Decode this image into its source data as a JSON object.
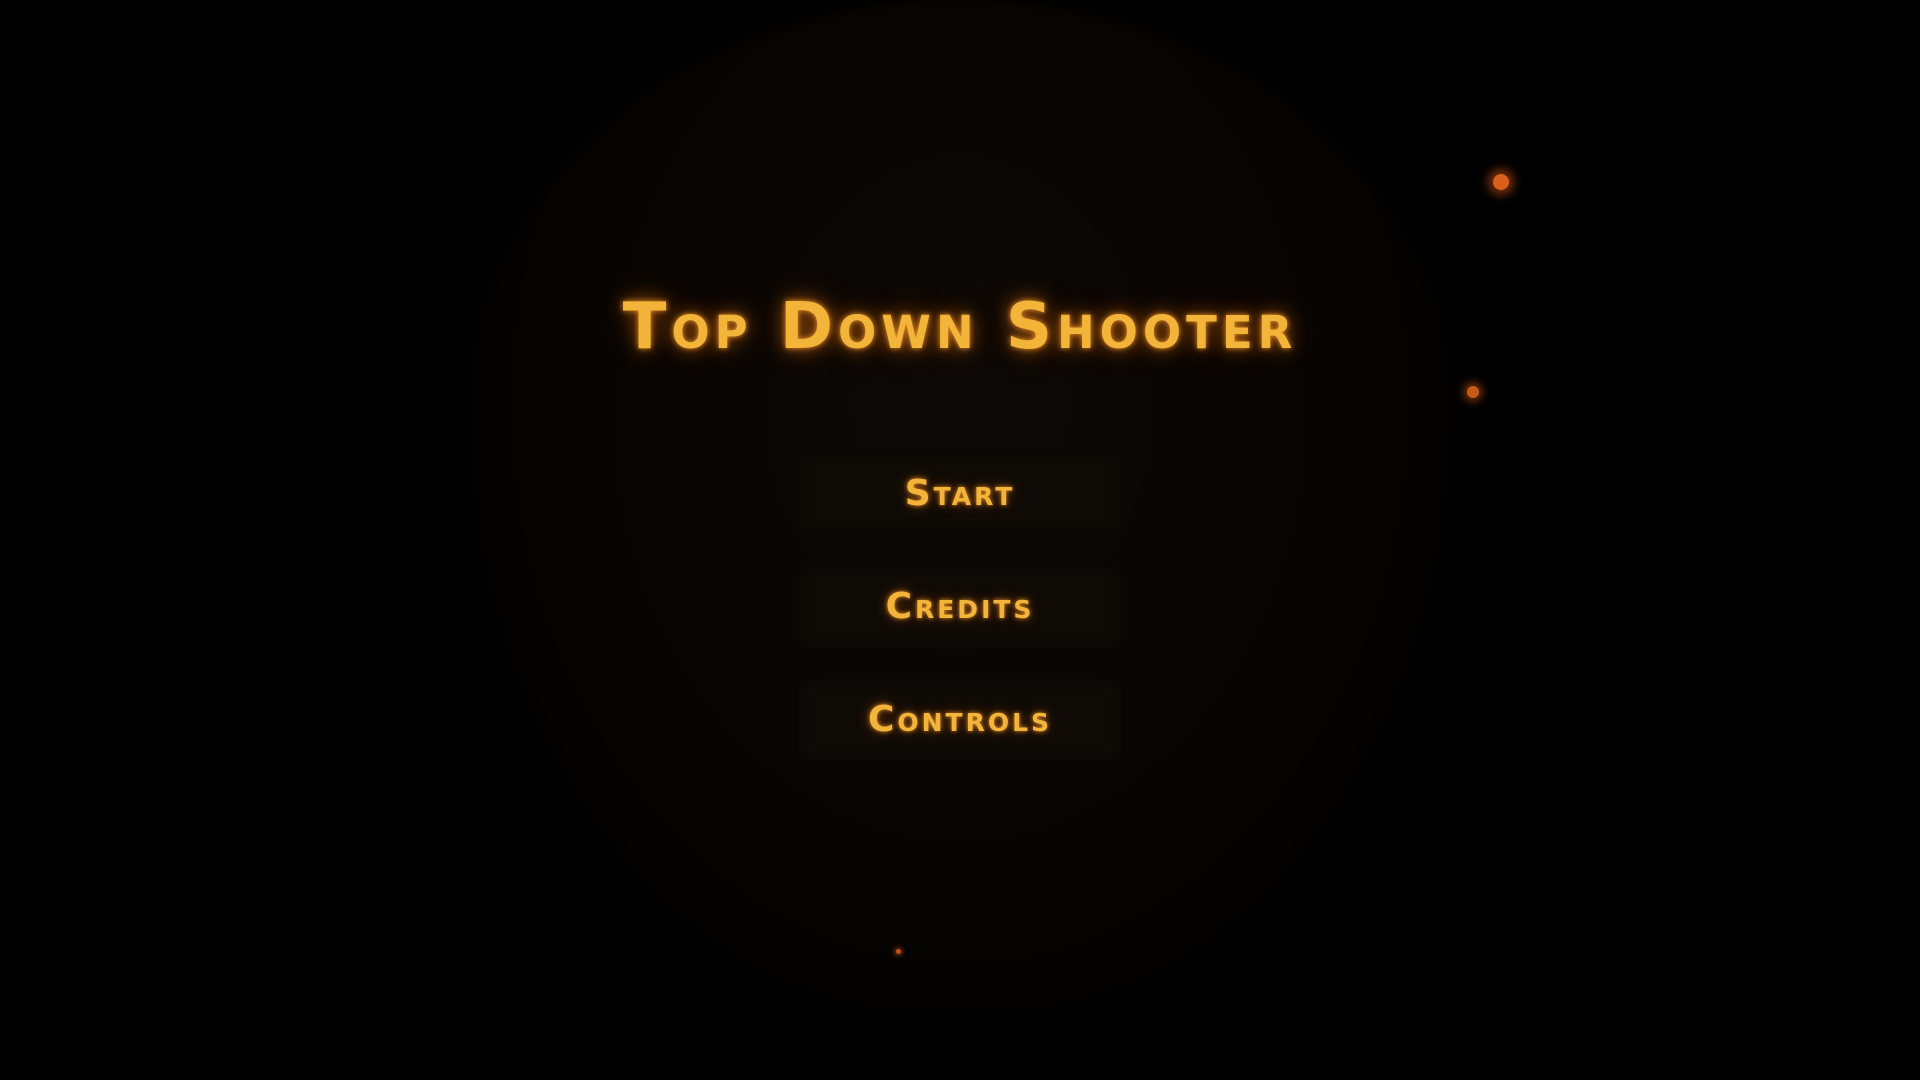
{
  "game": {
    "title": "Top Down Shooter"
  },
  "main_menu": {
    "buttons": [
      {
        "label": "Start"
      },
      {
        "label": "Credits"
      },
      {
        "label": "Controls"
      }
    ]
  },
  "colors": {
    "background": "#000000",
    "text_glow": "#f3b43a",
    "button_background": "#0e0a06",
    "ember": "#e06a1a"
  }
}
